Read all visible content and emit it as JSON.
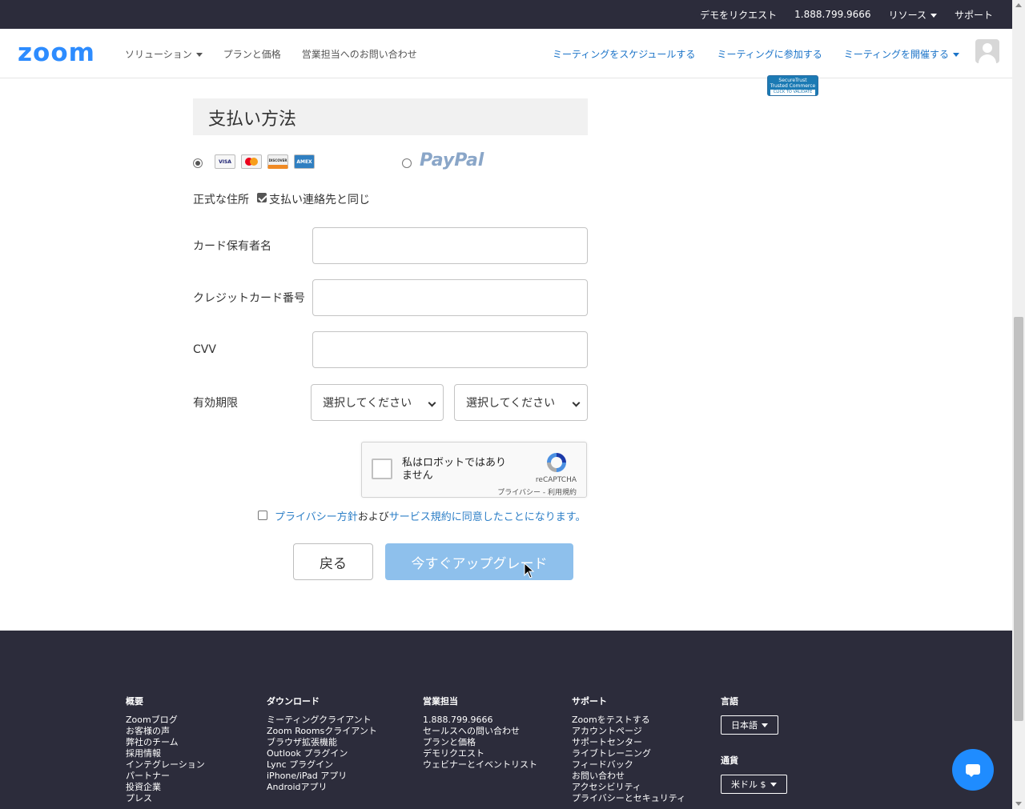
{
  "topbar": {
    "demo": "デモをリクエスト",
    "phone": "1.888.799.9666",
    "resources": "リソース",
    "support": "サポート"
  },
  "nav": {
    "logo": "zoom",
    "solutions": "ソリューション",
    "plans": "プランと価格",
    "sales": "営業担当へのお問い合わせ",
    "schedule": "ミーティングをスケジュールする",
    "join": "ミーティングに参加する",
    "host": "ミーティングを開催する"
  },
  "seal": {
    "line1": "SecureTrust",
    "line2": "Trusted Commerce",
    "line3": "CLICK TO VALIDATE"
  },
  "payment": {
    "title": "支払い方法",
    "cards": [
      "VISA",
      "",
      "DISCOVER",
      "AMEX"
    ],
    "paypal": "PayPal",
    "method_selected": "card",
    "address_label": "正式な住所",
    "same_as_contact": "支払い連絡先と同じ",
    "cardholder_label": "カード保有者名",
    "cardnumber_label": "クレジットカード番号",
    "cvv_label": "CVV",
    "expiry_label": "有効期限",
    "expiry_month": "選択してください",
    "expiry_year": "選択してください"
  },
  "recaptcha": {
    "text": "私はロボットではありません",
    "brand": "reCAPTCHA",
    "links": "プライバシー - 利用規約"
  },
  "terms": {
    "privacy": "プライバシー方針",
    "and": "および",
    "tos": "サービス規約に同意したことになります。"
  },
  "buttons": {
    "back": "戻る",
    "upgrade": "今すぐアップグレード"
  },
  "footer": {
    "about": {
      "title": "概要",
      "items": [
        "Zoomブログ",
        "お客様の声",
        "弊社のチーム",
        "採用情報",
        "インテグレーション",
        "パートナー",
        "投資企業",
        "プレス"
      ]
    },
    "download": {
      "title": "ダウンロード",
      "items": [
        "ミーティングクライアント",
        "Zoom Roomsクライアント",
        "ブラウザ拡張機能",
        "Outlook プラグイン",
        "Lync プラグイン",
        "iPhone/iPad アプリ",
        "Androidアプリ"
      ]
    },
    "sales": {
      "title": "営業担当",
      "items": [
        "1.888.799.9666",
        "セールスへの問い合わせ",
        "プランと価格",
        "デモリクエスト",
        "ウェビナーとイベントリスト"
      ]
    },
    "support": {
      "title": "サポート",
      "items": [
        "Zoomをテストする",
        "アカウントページ",
        "サポートセンター",
        "ライブトレーニング",
        "フィードバック",
        "お問い合わせ",
        "アクセシビリティ",
        "プライバシーとセキュリティ"
      ]
    },
    "language": {
      "title": "言語",
      "value": "日本語"
    },
    "currency": {
      "title": "通貨",
      "value": "米ドル $"
    }
  },
  "colors": {
    "brand": "#2d8cff",
    "dark": "#2c2c3b",
    "upgrade_button": "#8ec0ec",
    "link": "#2d7fc7"
  }
}
